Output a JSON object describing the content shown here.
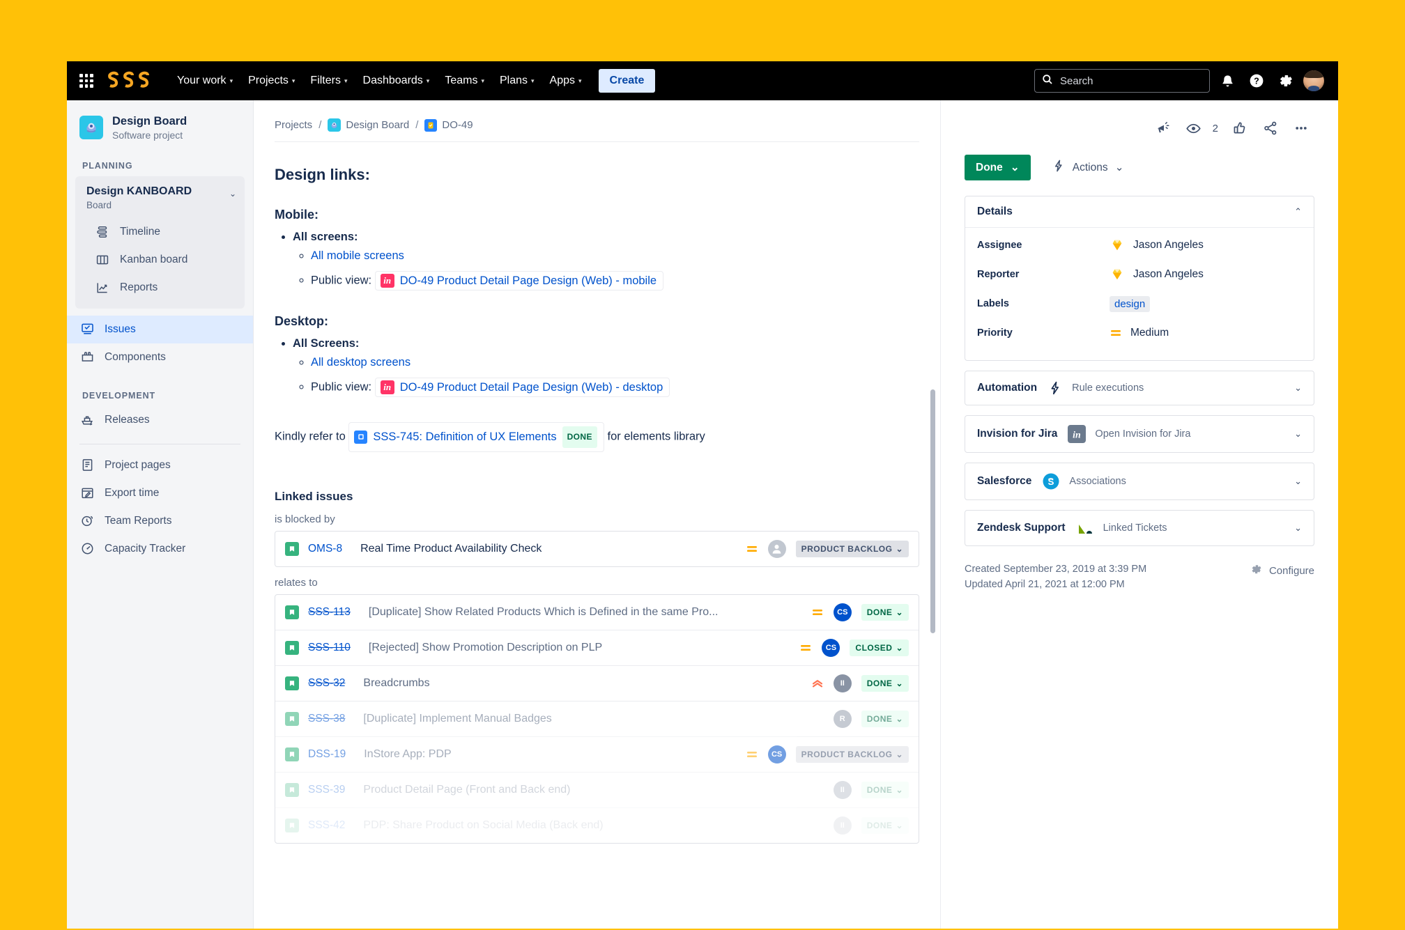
{
  "topnav": {
    "apps_icon": "app-switcher-icon",
    "logo_text": "SSS",
    "items": [
      {
        "label": "Your work",
        "has_caret": true
      },
      {
        "label": "Projects",
        "has_caret": true
      },
      {
        "label": "Filters",
        "has_caret": true
      },
      {
        "label": "Dashboards",
        "has_caret": true
      },
      {
        "label": "Teams",
        "has_caret": true
      },
      {
        "label": "Plans",
        "has_caret": true
      },
      {
        "label": "Apps",
        "has_caret": true
      }
    ],
    "create_label": "Create",
    "search_placeholder": "Search",
    "icons": [
      "notifications-bell-icon",
      "help-icon",
      "settings-gear-icon",
      "user-avatar"
    ]
  },
  "sidebar": {
    "project_name": "Design Board",
    "project_type": "Software project",
    "planning_label": "PLANNING",
    "board_group": {
      "title": "Design KANBOARD",
      "subtitle": "Board",
      "items": [
        {
          "label": "Timeline",
          "icon": "timeline-icon"
        },
        {
          "label": "Kanban board",
          "icon": "board-columns-icon"
        },
        {
          "label": "Reports",
          "icon": "reports-chart-icon"
        }
      ]
    },
    "top_items": [
      {
        "label": "Issues",
        "icon": "issues-icon",
        "active": true
      },
      {
        "label": "Components",
        "icon": "components-icon",
        "active": false
      }
    ],
    "development_label": "DEVELOPMENT",
    "dev_items": [
      {
        "label": "Releases",
        "icon": "releases-ship-icon"
      }
    ],
    "other_items": [
      {
        "label": "Project pages",
        "icon": "pages-icon"
      },
      {
        "label": "Export time",
        "icon": "calendar-edit-icon"
      },
      {
        "label": "Team Reports",
        "icon": "clock-report-icon"
      },
      {
        "label": "Capacity Tracker",
        "icon": "gauge-icon"
      }
    ]
  },
  "breadcrumb": {
    "projects": "Projects",
    "board": "Design Board",
    "issue_key": "DO-49",
    "sep": "/"
  },
  "description": {
    "heading": "Design links:",
    "mobile_heading": "Mobile:",
    "mobile_bullet": "All screens:",
    "mobile_link_all": "All mobile screens",
    "mobile_public_label": "Public view:",
    "mobile_public_link": "DO-49 Product Detail Page Design (Web) - mobile",
    "desktop_heading": "Desktop:",
    "desktop_bullet": "All Screens:",
    "desktop_link_all": "All desktop screens",
    "desktop_public_label": "Public view:",
    "desktop_public_link": "DO-49 Product Detail Page Design (Web) - desktop",
    "ref_prefix": "Kindly refer to",
    "ref_link": "SSS-745: Definition of UX Elements",
    "ref_badge": "DONE",
    "ref_suffix": "for elements library",
    "invision_mark": "in"
  },
  "linked_issues": {
    "heading": "Linked issues",
    "groups": [
      {
        "type_label": "is blocked by",
        "rows": [
          {
            "key": "OMS-8",
            "struck": false,
            "summary": "Real Time Product Availability Check",
            "priority": "medium",
            "avatar": "",
            "avatar_kind": "blank",
            "status": "PRODUCT BACKLOG",
            "status_kind": "backlog",
            "fade": 0
          }
        ]
      },
      {
        "type_label": "relates to",
        "rows": [
          {
            "key": "SSS-113",
            "struck": true,
            "summary": "[Duplicate] Show Related Products Which is Defined in the same Pro...",
            "priority": "medium",
            "avatar": "CS",
            "avatar_kind": "cs",
            "status": "DONE",
            "status_kind": "done",
            "fade": 0
          },
          {
            "key": "SSS-110",
            "struck": true,
            "summary": "[Rejected] Show Promotion Description on PLP",
            "priority": "medium",
            "avatar": "CS",
            "avatar_kind": "cs",
            "status": "CLOSED",
            "status_kind": "closed",
            "fade": 0
          },
          {
            "key": "SSS-32",
            "struck": true,
            "summary": "Breadcrumbs",
            "priority": "high",
            "avatar": "II",
            "avatar_kind": "ii",
            "status": "DONE",
            "status_kind": "done",
            "fade": 0
          },
          {
            "key": "SSS-38",
            "struck": true,
            "summary": "[Duplicate] Implement Manual Badges",
            "priority": "none",
            "avatar": "R",
            "avatar_kind": "r",
            "status": "DONE",
            "status_kind": "done",
            "fade": 1
          },
          {
            "key": "DSS-19",
            "struck": false,
            "summary": "InStore App: PDP",
            "priority": "medium",
            "avatar": "CS",
            "avatar_kind": "cs",
            "status": "PRODUCT BACKLOG",
            "status_kind": "backlog",
            "fade": 1
          },
          {
            "key": "SSS-39",
            "struck": false,
            "summary": "Product Detail Page (Front and Back end)",
            "priority": "none",
            "avatar": "II",
            "avatar_kind": "ii",
            "status": "DONE",
            "status_kind": "done",
            "fade": 2
          },
          {
            "key": "SSS-42",
            "struck": false,
            "summary": "PDP: Share Product on Social Media (Back end)",
            "priority": "none",
            "avatar": "II",
            "avatar_kind": "ii",
            "status": "DONE",
            "status_kind": "done",
            "fade": 3
          }
        ]
      }
    ]
  },
  "right_panel": {
    "watch_count": "2",
    "action_icons": [
      "megaphone-feedback-icon",
      "watch-eye-icon",
      "thumbs-up-icon",
      "share-icon",
      "more-actions-icon"
    ],
    "status_button": "Done",
    "actions_button": "Actions",
    "details": {
      "title": "Details",
      "rows": [
        {
          "label": "Assignee",
          "value": "Jason Angeles",
          "kind": "user"
        },
        {
          "label": "Reporter",
          "value": "Jason Angeles",
          "kind": "user"
        },
        {
          "label": "Labels",
          "value": "design",
          "kind": "label"
        },
        {
          "label": "Priority",
          "value": "Medium",
          "kind": "priority"
        }
      ]
    },
    "apps": [
      {
        "title": "Automation",
        "meta": "Rule executions",
        "icon": "automation-bolt-icon"
      },
      {
        "title": "Invision for Jira",
        "meta": "Open Invision for Jira",
        "icon": "invision-icon"
      },
      {
        "title": "Salesforce",
        "meta": "Associations",
        "icon": "salesforce-cloud-icon"
      },
      {
        "title": "Zendesk Support",
        "meta": "Linked Tickets",
        "icon": "zendesk-icon"
      }
    ],
    "created": "Created September 23, 2019 at 3:39 PM",
    "updated": "Updated April 21, 2021 at 12:00 PM",
    "configure": "Configure"
  },
  "colors": {
    "brand_yellow": "#FFC107",
    "jira_blue": "#0052CC",
    "done_green": "#00875A",
    "nav_black": "#000000"
  }
}
